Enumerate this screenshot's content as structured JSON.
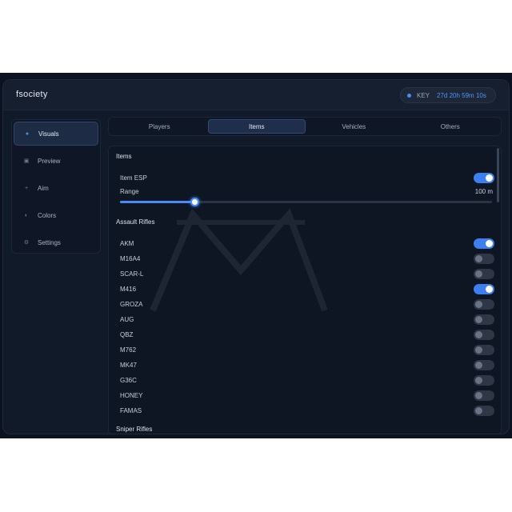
{
  "app": {
    "title": "fsociety"
  },
  "key": {
    "label": "KEY",
    "value": "27d 20h 59m 10s"
  },
  "sidebar": {
    "items": [
      {
        "label": "Visuals",
        "icon": "dot-icon",
        "active": true
      },
      {
        "label": "Preview",
        "icon": "square-icon",
        "active": false
      },
      {
        "label": "Aim",
        "icon": "crosshair-icon",
        "active": false
      },
      {
        "label": "Colors",
        "icon": "palette-icon",
        "active": false
      },
      {
        "label": "Settings",
        "icon": "gear-icon",
        "active": false
      }
    ]
  },
  "tabs": [
    {
      "label": "Players",
      "active": false
    },
    {
      "label": "Items",
      "active": true
    },
    {
      "label": "Vehicles",
      "active": false
    },
    {
      "label": "Others",
      "active": false
    }
  ],
  "content": {
    "section_items": "Items",
    "item_esp": {
      "label": "Item ESP",
      "on": true
    },
    "range": {
      "label": "Range",
      "value": "100 m",
      "fraction": 0.2
    },
    "section_assault": "Assault Rifles",
    "weapons": [
      {
        "label": "AKM",
        "on": true
      },
      {
        "label": "M16A4",
        "on": false
      },
      {
        "label": "SCAR-L",
        "on": false
      },
      {
        "label": "M416",
        "on": true
      },
      {
        "label": "GROZA",
        "on": false
      },
      {
        "label": "AUG",
        "on": false
      },
      {
        "label": "QBZ",
        "on": false
      },
      {
        "label": "M762",
        "on": false
      },
      {
        "label": "MK47",
        "on": false
      },
      {
        "label": "G36C",
        "on": false
      },
      {
        "label": "HONEY",
        "on": false
      },
      {
        "label": "FAMAS",
        "on": false
      }
    ],
    "section_sniper": "Sniper Rifles"
  },
  "colors": {
    "accent": "#4a8cf5",
    "toggle_on": "#3b7ff0",
    "toggle_off": "#2f3746"
  }
}
